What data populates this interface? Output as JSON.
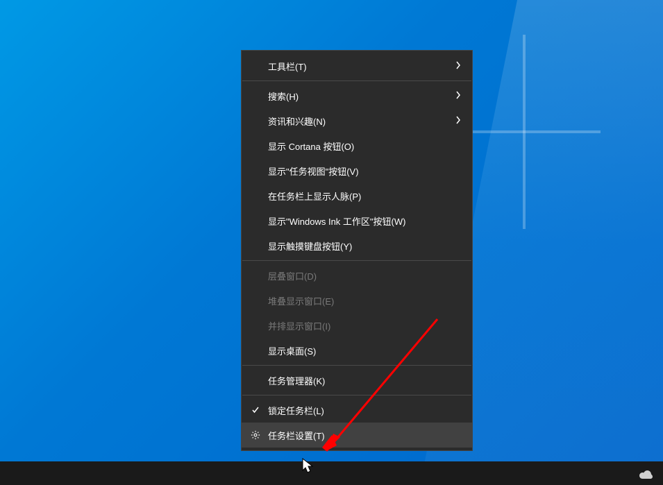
{
  "menu": {
    "toolbars": "工具栏(T)",
    "search": "搜索(H)",
    "news_interests": "资讯和兴趣(N)",
    "show_cortana": "显示 Cortana 按钮(O)",
    "show_taskview": "显示\"任务视图\"按钮(V)",
    "show_people": "在任务栏上显示人脉(P)",
    "show_ink": "显示\"Windows Ink 工作区\"按钮(W)",
    "show_touch_keyboard": "显示触摸键盘按钮(Y)",
    "cascade": "层叠窗口(D)",
    "stacked": "堆叠显示窗口(E)",
    "sidebyside": "并排显示窗口(I)",
    "show_desktop": "显示桌面(S)",
    "task_manager": "任务管理器(K)",
    "lock_taskbar": "锁定任务栏(L)",
    "taskbar_settings": "任务栏设置(T)"
  }
}
